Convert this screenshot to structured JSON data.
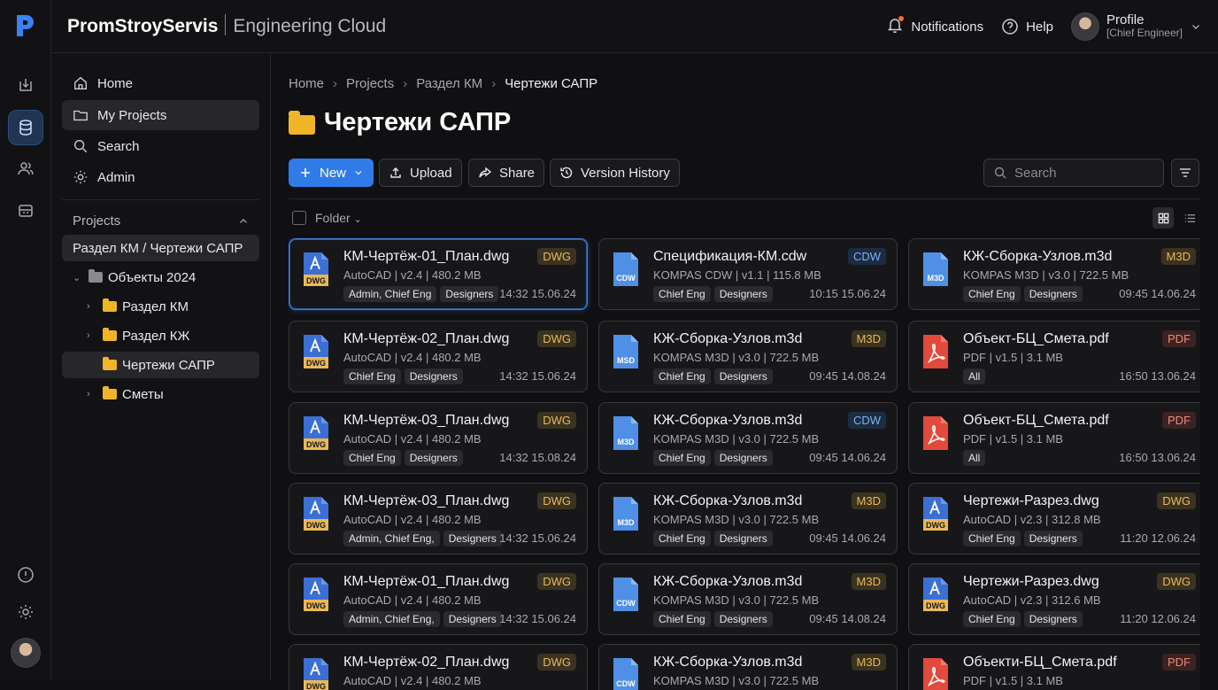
{
  "brand": {
    "name": "PromStroyServis",
    "sub": "Engineering Cloud"
  },
  "topbar": {
    "notifications": "Notifications",
    "help": "Help",
    "profile": "Profile",
    "role": "[Chief Engineer]"
  },
  "sidebar": {
    "nav": [
      {
        "label": "Home",
        "icon": "home-icon"
      },
      {
        "label": "My Projects",
        "icon": "folder-icon"
      },
      {
        "label": "Search",
        "icon": "search-icon"
      },
      {
        "label": "Admin",
        "icon": "gear-icon"
      }
    ],
    "projects_heading": "Projects",
    "current_path": "Раздел КМ / Чертежи САПР",
    "tree": [
      {
        "label": "Объекты 2024",
        "level": 0
      },
      {
        "label": "Раздел КМ",
        "level": 1
      },
      {
        "label": "Раздел КЖ",
        "level": 1
      },
      {
        "label": "Чертежи САПР",
        "level": 1
      },
      {
        "label": "Сметы",
        "level": 1
      }
    ]
  },
  "breadcrumb": [
    "Home",
    "Projects",
    "Раздел КМ",
    "Чертежи САПР"
  ],
  "page_title": "Чертежи САПР",
  "toolbar": {
    "new": "New",
    "upload": "Upload",
    "share": "Share",
    "version_history": "Version History",
    "search_placeholder": "Search"
  },
  "list_header": {
    "sort": "Folder"
  },
  "colors": {
    "accent": "#2f7be8",
    "folder": "#f0b429",
    "dwg": "#e8b85a",
    "cdw": "#7fb0f0",
    "pdf": "#e14a3c"
  },
  "files": [
    {
      "name": "КМ-Чертёж-01_План.dwg",
      "meta": "AutoCAD | v2.4 | 480.2 MB",
      "tags": [
        "Admin, Chief Eng",
        "Designers"
      ],
      "date": "14:32 15.06.24",
      "badge": "DWG",
      "icon": "DWG"
    },
    {
      "name": "Спецификация-КМ.cdw",
      "meta": "KOMPAS CDW | v1.1 | 115.8 MB",
      "tags": [
        "Chief Eng",
        "Designers"
      ],
      "date": "10:15 15.06.24",
      "badge": "CDW",
      "icon": "CDW"
    },
    {
      "name": "КЖ-Сборка-Узлов.m3d",
      "meta": "KOMPAS M3D | v3.0 | 722.5 MB",
      "tags": [
        "Chief Eng",
        "Designers"
      ],
      "date": "09:45 14.06.24",
      "badge": "M3D",
      "icon": "M3D"
    },
    {
      "name": "КМ-Чертёж-02_План.dwg",
      "meta": "AutoCAD | v2.4 | 480.2 MB",
      "tags": [
        "Chief Eng",
        "Designers"
      ],
      "date": "14:32 15.06.24",
      "badge": "DWG",
      "icon": "DWG"
    },
    {
      "name": "КЖ-Сборка-Узлов.m3d",
      "meta": "KOMPAS M3D | v3.0 | 722.5 MB",
      "tags": [
        "Chief Eng",
        "Designers"
      ],
      "date": "09:45 14.08.24",
      "badge": "M3D",
      "icon": "MSD"
    },
    {
      "name": "Объект-БЦ_Смета.pdf",
      "meta": "PDF | v1.5 | 3.1 MB",
      "tags": [
        "All"
      ],
      "date": "16:50 13.06.24",
      "badge": "PDF",
      "icon": "PDF"
    },
    {
      "name": "КМ-Чертёж-03_План.dwg",
      "meta": "AutoCAD | v2.4 | 480.2 MB",
      "tags": [
        "Chief Eng",
        "Designers"
      ],
      "date": "14:32 15.08.24",
      "badge": "DWG",
      "icon": "DWG"
    },
    {
      "name": "КЖ-Сборка-Узлов.m3d",
      "meta": "KOMPAS M3D | v3.0 | 722.5 MB",
      "tags": [
        "Chief Eng",
        "Designers"
      ],
      "date": "09:45 14.06.24",
      "badge": "CDW",
      "icon": "M3D"
    },
    {
      "name": "Объект-БЦ_Смета.pdf",
      "meta": "PDF | v1.5 | 3.1 MB",
      "tags": [
        "All"
      ],
      "date": "16:50 13.06.24",
      "badge": "PDF",
      "icon": "PDF"
    },
    {
      "name": "КМ-Чертёж-03_План.dwg",
      "meta": "AutoCAD | v2.4 | 480.2 MB",
      "tags": [
        "Admin, Chief Eng,",
        "Designers"
      ],
      "date": "14:32 15.06.24",
      "badge": "DWG",
      "icon": "DWG"
    },
    {
      "name": "КЖ-Сборка-Узлов.m3d",
      "meta": "KOMPAS M3D | v3.0 | 722.5 MB",
      "tags": [
        "Chief Eng",
        "Designers"
      ],
      "date": "09:45 14.06.24",
      "badge": "M3D",
      "icon": "M3D"
    },
    {
      "name": "Чертежи-Разрез.dwg",
      "meta": "AutoCAD | v2.3 | 312.8 MB",
      "tags": [
        "Chief Eng",
        "Designers"
      ],
      "date": "11:20 12.06.24",
      "badge": "DWG",
      "icon": "DWG"
    },
    {
      "name": "КМ-Чертёж-01_План.dwg",
      "meta": "AutoCAD | v2.4 | 480.2 MB",
      "tags": [
        "Admin, Chief Eng,",
        "Designers"
      ],
      "date": "14:32 15.06.24",
      "badge": "DWG",
      "icon": "DWG"
    },
    {
      "name": "КЖ-Сборка-Узлов.m3d",
      "meta": "KOMPAS M3D | v3.0 | 722.5 MB",
      "tags": [
        "Chief Eng",
        "Designers"
      ],
      "date": "09:45 14.08.24",
      "badge": "M3D",
      "icon": "CDW"
    },
    {
      "name": "Чертежи-Разрез.dwg",
      "meta": "AutoCAD | v2.3 | 312.6 MB",
      "tags": [
        "Chief Eng",
        "Designers"
      ],
      "date": "11:20 12.06.24",
      "badge": "DWG",
      "icon": "DWG"
    },
    {
      "name": "КМ-Чертёж-02_План.dwg",
      "meta": "AutoCAD | v2.4 | 480.2 MB",
      "tags": [],
      "date": "",
      "badge": "DWG",
      "icon": "DWG"
    },
    {
      "name": "КЖ-Сборка-Узлов.m3d",
      "meta": "KOMPAS M3D | v3.0 | 722.5 MB",
      "tags": [],
      "date": "",
      "badge": "M3D",
      "icon": "CDW"
    },
    {
      "name": "Объекти-БЦ_Смета.pdf",
      "meta": "PDF | v1.5 | 3.1 MB",
      "tags": [],
      "date": "",
      "badge": "PDF",
      "icon": "PDF"
    }
  ]
}
